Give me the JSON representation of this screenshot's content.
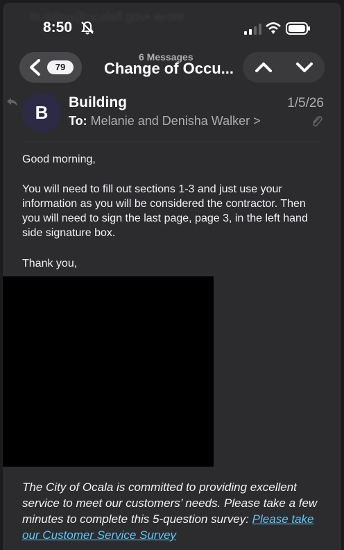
{
  "ghost_url": "building@ocalafl.gov• wrote:",
  "status_bar": {
    "time": "8:50",
    "icons": [
      "bell-slash-icon",
      "cellular-signal-icon",
      "wifi-icon",
      "battery-icon"
    ]
  },
  "nav": {
    "unread_count": "79",
    "thread_subtitle": "6 Messages",
    "thread_title": "Change of Occu...",
    "icons": [
      "chevron-left-icon",
      "chevron-up-icon",
      "chevron-down-icon"
    ]
  },
  "message": {
    "avatar_initial": "B",
    "sender": "Building",
    "to_prefix": "To:",
    "recipients": "Melanie and Denisha Walker",
    "recipients_chevron": ">",
    "date": "1/5/26",
    "greeting": "Good morning,",
    "paragraph": "You will need to fill out sections 1-3 and just use your information as you will be considered the contractor. Then you will need to sign the last page, page 3, in the left hand side signature box.",
    "signoff": "Thank you,",
    "footer_text": "The City of Ocala is committed to providing excellent service to meet our customers’ needs. Please take a few minutes to complete this 5-question survey: ",
    "survey_link": "Please take our Customer Service Survey"
  },
  "colors": {
    "background": "#2c2c2e",
    "link": "#5ac8fa",
    "avatar": "#2c2a44"
  }
}
